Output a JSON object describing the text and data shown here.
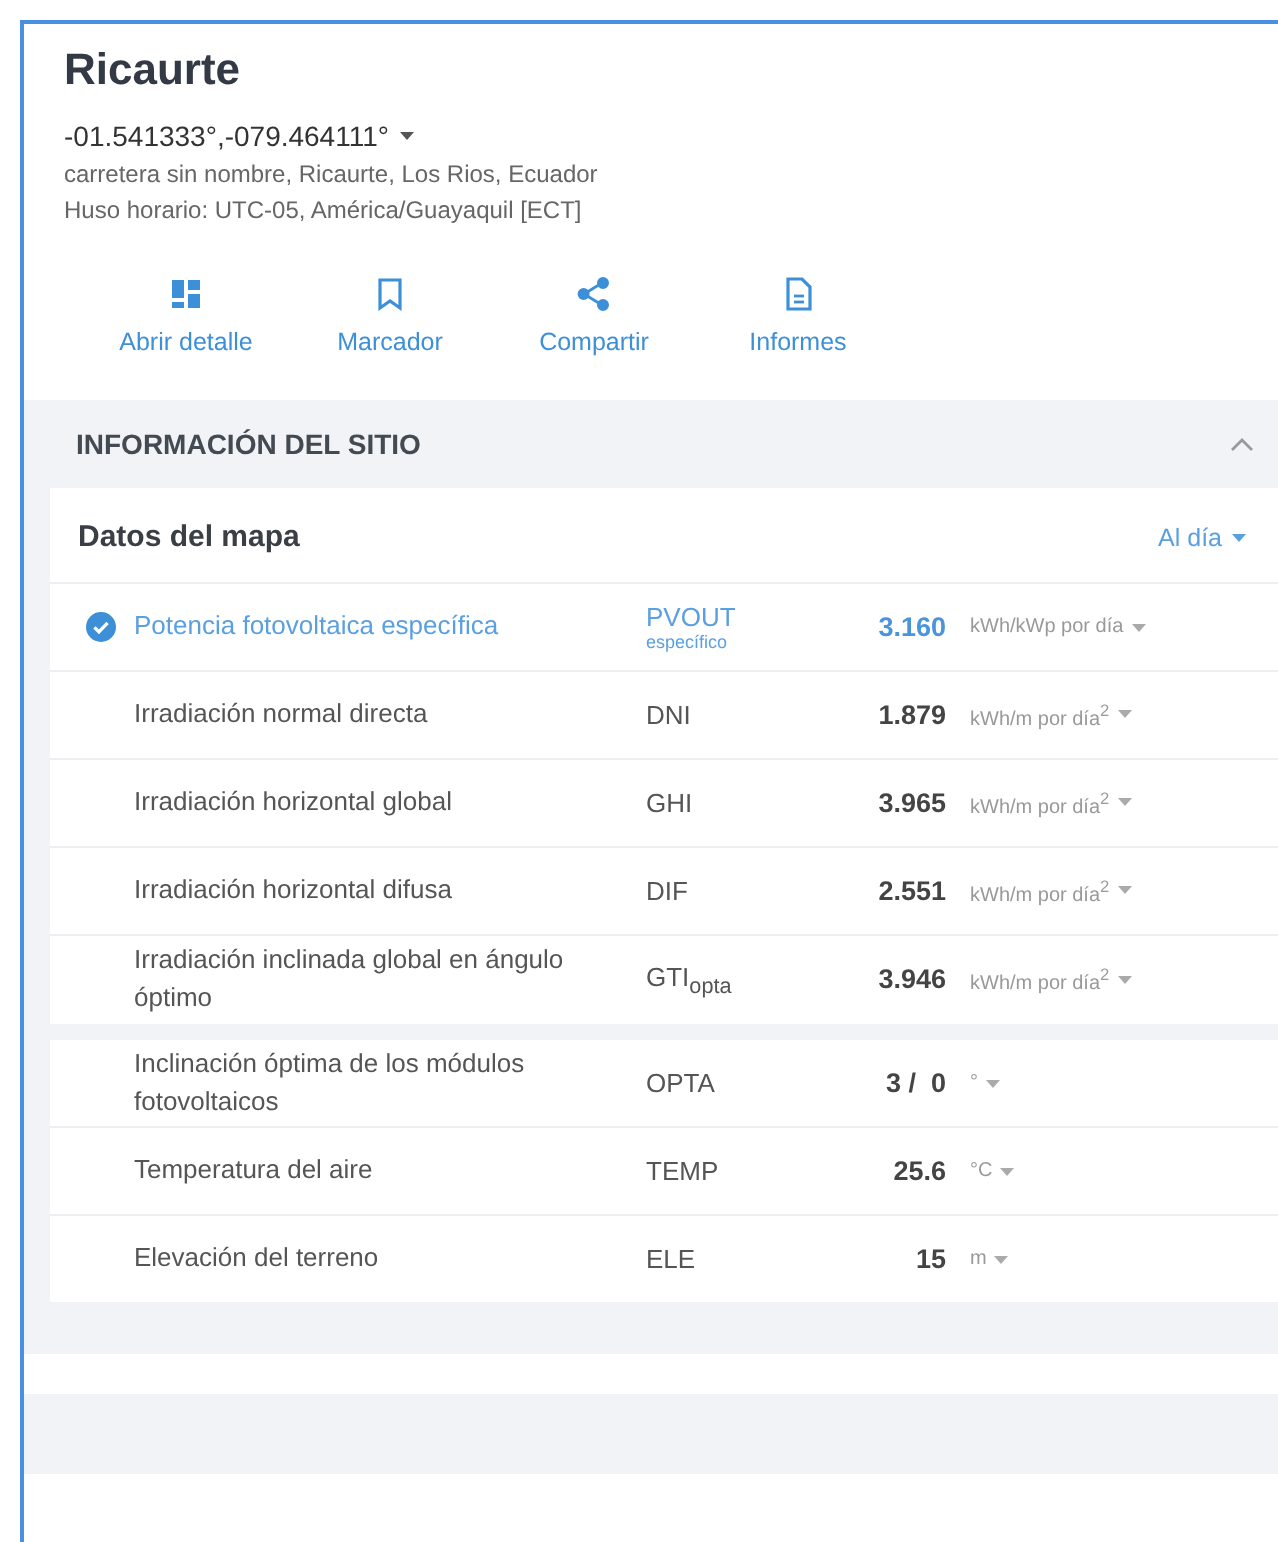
{
  "site": {
    "title": "Ricaurte",
    "coordinates": "-01.541333°,-079.464111°",
    "address": "carretera sin nombre, Ricaurte, Los Rios, Ecuador",
    "timezone": "Huso horario: UTC-05, América/Guayaquil [ECT]"
  },
  "actions": [
    {
      "kind": "detail",
      "label": "Abrir detalle"
    },
    {
      "kind": "bookmark",
      "label": "Marcador"
    },
    {
      "kind": "share",
      "label": "Compartir"
    },
    {
      "kind": "report",
      "label": "Informes"
    }
  ],
  "section": {
    "title": "INFORMACIÓN DEL SITIO",
    "expanded": true
  },
  "map_data": {
    "title": "Datos del mapa",
    "period": "Al día",
    "groups": [
      {
        "rows": [
          {
            "name": "Potencia fotovoltaica específica",
            "code": "PVOUT",
            "code_note": "específico",
            "value": "3.160",
            "unit": "kWh/kWp por día",
            "selected": true
          },
          {
            "name": "Irradiación normal directa",
            "code": "DNI",
            "value": "1.879",
            "unit": "kWh/m por día$^{2}$",
            "selected": false
          },
          {
            "name": "Irradiación horizontal global",
            "code": "GHI",
            "value": "3.965",
            "unit": "kWh/m por día$^{2}$",
            "selected": false
          },
          {
            "name": "Irradiación horizontal difusa",
            "code": "DIF",
            "value": "2.551",
            "unit": "kWh/m por día$^{2}$",
            "selected": false
          },
          {
            "name": "Irradiación inclinada global en ángulo óptimo",
            "code": "GTI$_{opta}$",
            "value": "3.946",
            "unit": "kWh/m por día$^{2}$",
            "selected": false
          }
        ]
      },
      {
        "rows": [
          {
            "name": "Inclinación óptima de los módulos fotovoltaicos",
            "code": "OPTA",
            "value": "3 /  0",
            "unit": "°",
            "selected": false
          },
          {
            "name": "Temperatura del aire",
            "code": "TEMP",
            "value": "25.6",
            "unit": "°C",
            "selected": false
          },
          {
            "name": "Elevación del terreno",
            "code": "ELE",
            "value": "15",
            "unit": "m",
            "selected": false
          }
        ]
      }
    ]
  }
}
